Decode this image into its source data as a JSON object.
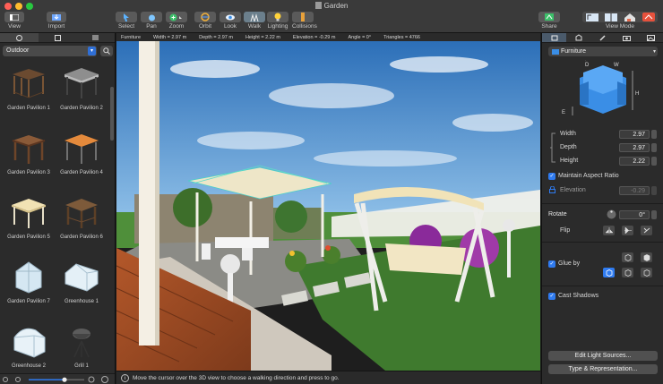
{
  "window": {
    "title": "Garden"
  },
  "toolbar": {
    "view": "View",
    "import": "Import",
    "select": "Select",
    "pan": "Pan",
    "zoom": "Zoom",
    "orbit": "Orbit",
    "look": "Look",
    "walk": "Walk",
    "lighting": "Lighting",
    "collisions": "Collisions",
    "share": "Share",
    "view_mode": "View Mode"
  },
  "library": {
    "category": "Outdoor",
    "items": [
      {
        "label": "Garden Pavilion 1"
      },
      {
        "label": "Garden Pavilion 2"
      },
      {
        "label": "Garden Pavilion 3"
      },
      {
        "label": "Garden Pavilion 4"
      },
      {
        "label": "Garden Pavilion 5"
      },
      {
        "label": "Garden Pavilion 6"
      },
      {
        "label": "Garden Pavilion 7"
      },
      {
        "label": "Greenhouse 1"
      },
      {
        "label": "Greenhouse 2"
      },
      {
        "label": "Grill 1"
      }
    ]
  },
  "infobar": {
    "type": "Furniture",
    "width": "Width = 2.97 m",
    "depth": "Depth = 2.97 m",
    "height": "Height = 2.22 m",
    "elevation": "Elevation = -0.29 m",
    "angle": "Angle = 0°",
    "triangles": "Triangles = 4766"
  },
  "status": {
    "text": "Move the cursor over the 3D view to choose a walking direction and press to go."
  },
  "inspector": {
    "object_type": "Furniture",
    "dim_d": "D",
    "dim_w": "W",
    "dim_h": "H",
    "dim_e": "E",
    "width_label": "Width",
    "width": "2.97",
    "depth_label": "Depth",
    "depth": "2.97",
    "height_label": "Height",
    "height": "2.22",
    "aspect_label": "Maintain Aspect Ratio",
    "elevation_label": "Elevation",
    "elevation": "-0.29",
    "rotate_label": "Rotate",
    "rotate": "0°",
    "flip_label": "Flip",
    "glue_label": "Glue by",
    "shadows_label": "Cast Shadows",
    "light_button": "Edit Light Sources...",
    "type_button": "Type & Representation..."
  },
  "colors": {
    "accent": "#2f7bf0",
    "chair_blue": "#3a8ee6"
  }
}
